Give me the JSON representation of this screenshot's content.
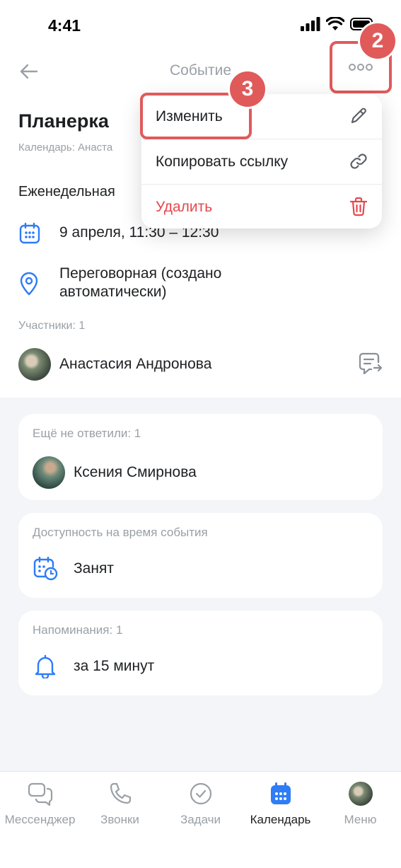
{
  "status_bar": {
    "time": "4:41"
  },
  "header": {
    "title": "Событие"
  },
  "badges": {
    "more": "2",
    "edit": "3"
  },
  "event": {
    "title": "Планерка",
    "calendar": "Календарь: Анаста",
    "recurrence": "Еженедельная",
    "datetime": "9 апреля, 11:30 – 12:30",
    "location": "Переговорная (создано автоматически)"
  },
  "participants": {
    "label": "Участники: 1",
    "items": [
      {
        "name": "Анастасия Андронова"
      }
    ]
  },
  "not_answered": {
    "label": "Ещё не ответили: 1",
    "items": [
      {
        "name": "Ксения Смирнова"
      }
    ]
  },
  "availability": {
    "label": "Доступность на время события",
    "value": "Занят"
  },
  "reminders": {
    "label": "Напоминания: 1",
    "value": "за 15 минут"
  },
  "menu": {
    "items": [
      {
        "label": "Изменить",
        "icon": "pencil-icon"
      },
      {
        "label": "Копировать ссылку",
        "icon": "link-icon"
      },
      {
        "label": "Удалить",
        "icon": "trash-icon"
      }
    ]
  },
  "tabbar": {
    "tabs": [
      {
        "label": "Мессенджер",
        "icon": "chat-icon"
      },
      {
        "label": "Звонки",
        "icon": "phone-icon"
      },
      {
        "label": "Задачи",
        "icon": "check-circle-icon"
      },
      {
        "label": "Календарь",
        "icon": "calendar-icon",
        "active": true
      },
      {
        "label": "Меню",
        "icon": "avatar"
      }
    ]
  },
  "colors": {
    "accent": "#2e7cf6",
    "danger": "#e5484d",
    "annotation": "#e05a5a"
  }
}
